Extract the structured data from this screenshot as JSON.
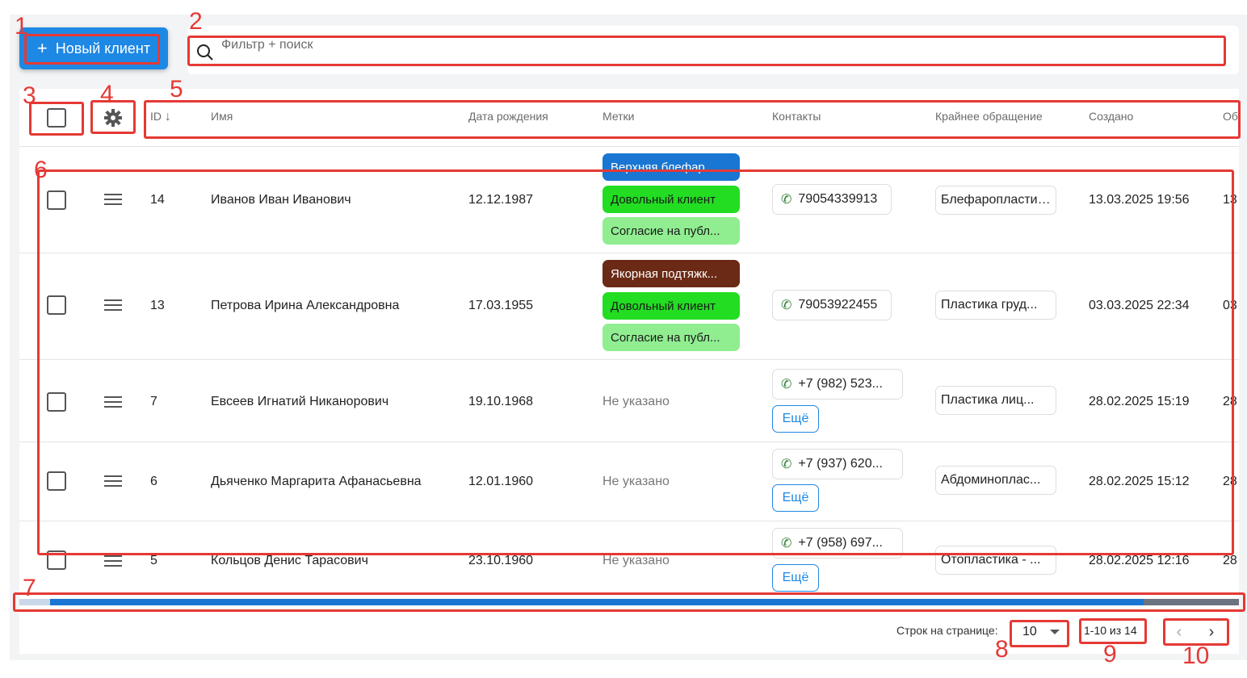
{
  "toolbar": {
    "new_client_label": "Новый клиент",
    "search_placeholder": "Фильтр + поиск"
  },
  "columns": {
    "id": "ID",
    "name": "Имя",
    "birth": "Дата рождения",
    "tags": "Метки",
    "contacts": "Контакты",
    "last_appeal": "Крайнее обращение",
    "created": "Создано",
    "overflow": "Об"
  },
  "rows": [
    {
      "id": "14",
      "name": "Иванов Иван Иванович",
      "birth": "12.12.1987",
      "tags": [
        {
          "label": "Верхняя блефар...",
          "bg": "#1976d2",
          "fg": "#ffffff"
        },
        {
          "label": "Довольный клиент",
          "bg": "#22dd22",
          "fg": "#1a1a1a"
        },
        {
          "label": "Согласие на публ...",
          "bg": "#90ee90",
          "fg": "#1a1a1a"
        }
      ],
      "contact": "79054339913",
      "appeal": "Блефаропластика...",
      "created": "13.03.2025 19:56",
      "overflow": "13"
    },
    {
      "id": "13",
      "name": "Петрова Ирина Александровна",
      "birth": "17.03.1955",
      "tags": [
        {
          "label": "Якорная подтяжк...",
          "bg": "#6b2a15",
          "fg": "#ffffff"
        },
        {
          "label": "Довольный клиент",
          "bg": "#22dd22",
          "fg": "#1a1a1a"
        },
        {
          "label": "Согласие на публ...",
          "bg": "#90ee90",
          "fg": "#1a1a1a"
        }
      ],
      "contact": "79053922455",
      "appeal": "Пластика груд...",
      "created": "03.03.2025 22:34",
      "overflow": "03"
    },
    {
      "id": "7",
      "name": "Евсеев Игнатий Никанорович",
      "birth": "19.10.1968",
      "tags_empty": "Не указано",
      "contact": "+7 (982) 523...",
      "more": "Ещё",
      "appeal": "Пластика лиц...",
      "created": "28.02.2025 15:19",
      "overflow": "28"
    },
    {
      "id": "6",
      "name": "Дьяченко Маргарита Афанасьевна",
      "birth": "12.01.1960",
      "tags_empty": "Не указано",
      "contact": "+7 (937) 620...",
      "more": "Ещё",
      "appeal": "Абдоминоплас...",
      "created": "28.02.2025 15:12",
      "overflow": "28"
    },
    {
      "id": "5",
      "name": "Кольцов Денис Тарасович",
      "birth": "23.10.1960",
      "tags_empty": "Не указано",
      "contact": "+7 (958) 697...",
      "more": "Ещё",
      "appeal": "Отопластика - ...",
      "created": "28.02.2025 12:16",
      "overflow": "28"
    }
  ],
  "footer": {
    "rows_per_page_label": "Строк на странице:",
    "rows_per_page_value": "10",
    "range": "1-10 из 14"
  },
  "annotations": [
    "1",
    "2",
    "3",
    "4",
    "5",
    "6",
    "7",
    "8",
    "9",
    "10"
  ],
  "colors": {
    "accent": "#1e88e5",
    "annotation": "#e53935"
  }
}
